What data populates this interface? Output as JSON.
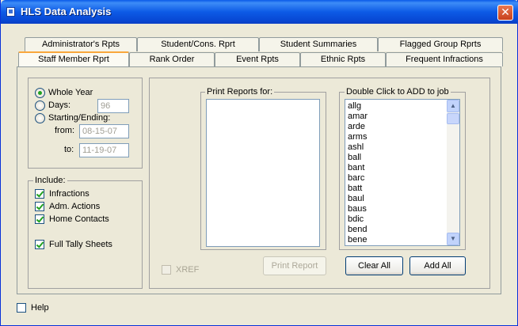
{
  "window": {
    "title": "HLS Data Analysis",
    "close_glyph": "✕"
  },
  "tabs_row1": [
    {
      "label": "Administrator's Rpts"
    },
    {
      "label": "Student/Cons. Rprt"
    },
    {
      "label": "Student Summaries"
    },
    {
      "label": "Flagged Group Rprts"
    }
  ],
  "tabs_row2": [
    {
      "label": "Staff Member Rprt",
      "active": true
    },
    {
      "label": "Rank Order"
    },
    {
      "label": "Event Rpts"
    },
    {
      "label": "Ethnic Rpts"
    },
    {
      "label": "Frequent Infractions"
    }
  ],
  "period": {
    "whole_year": "Whole Year",
    "days": "Days:",
    "days_value": "96",
    "starting_ending": "Starting/Ending:",
    "from_label": "from:",
    "from_value": "08-15-07",
    "to_label": "to:",
    "to_value": "11-19-07",
    "selected": "whole_year"
  },
  "include": {
    "title": "Include:",
    "items": [
      {
        "label": "Infractions",
        "checked": true
      },
      {
        "label": "Adm. Actions",
        "checked": true
      },
      {
        "label": "Home Contacts",
        "checked": true
      },
      {
        "label": "Full Tally Sheets",
        "checked": true
      }
    ]
  },
  "print_for": {
    "title": "Print Reports for:"
  },
  "add_list": {
    "title": "Double Click to ADD to job",
    "items": [
      "allg",
      "amar",
      "arde",
      "arms",
      "ashl",
      "ball",
      "bant",
      "barc",
      "batt",
      "baul",
      "baus",
      "bdic",
      "bend",
      "bene"
    ],
    "scroll_up_glyph": "▲",
    "scroll_down_glyph": "▼"
  },
  "xref": {
    "label": "XREF",
    "checked": false,
    "enabled": false
  },
  "buttons": {
    "print_report": "Print Report",
    "clear_all": "Clear All",
    "add_all": "Add All"
  },
  "help": {
    "label": "Help",
    "checked": false
  }
}
